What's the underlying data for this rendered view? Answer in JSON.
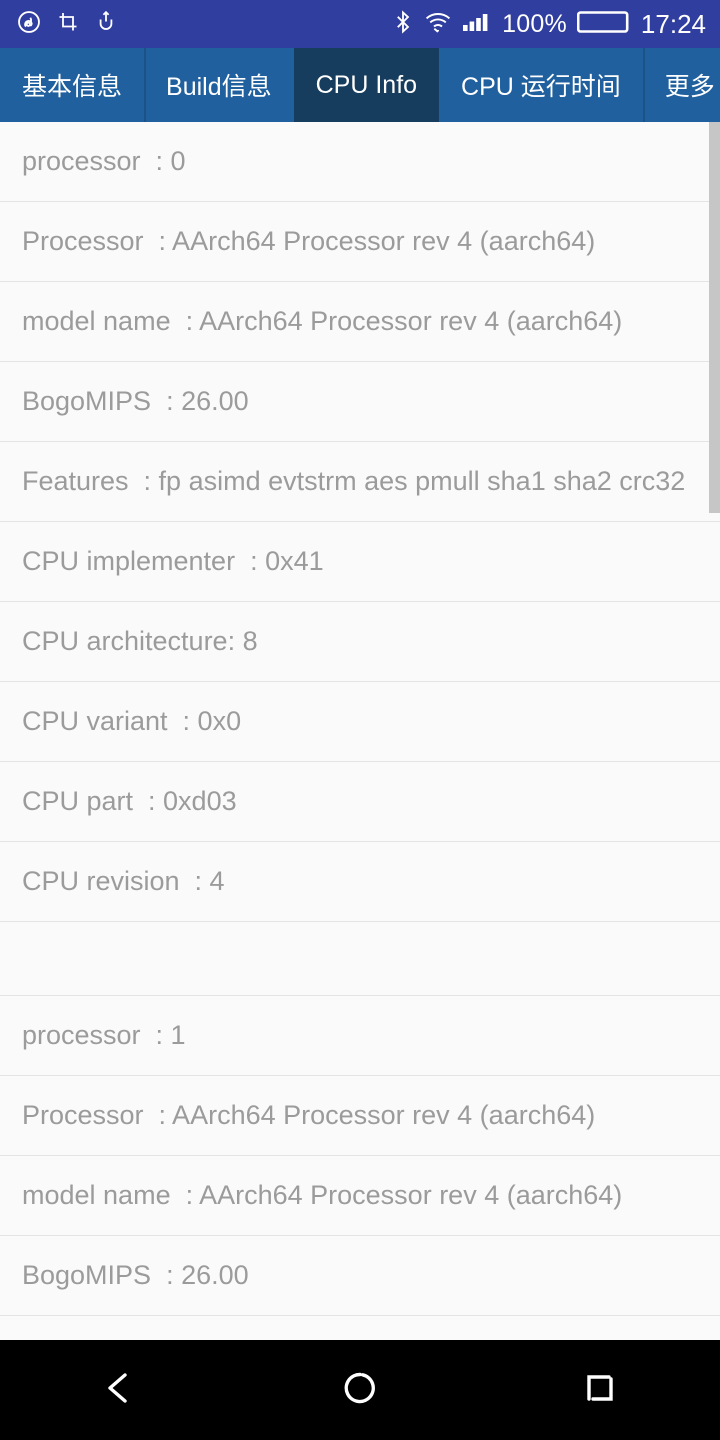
{
  "statusbar": {
    "notification_icons": [
      "music-note-icon",
      "screenshot-crop-icon",
      "usb-debug-icon"
    ],
    "bluetooth_icon": "bluetooth-icon",
    "wifi_icon": "wifi-icon",
    "signal_icon": "cellular-signal-icon",
    "battery_percent": "100%",
    "battery_icon": "battery-full-icon",
    "clock": "17:24"
  },
  "tabs": [
    {
      "label": "基本信息",
      "selected": false
    },
    {
      "label": "Build信息",
      "selected": false
    },
    {
      "label": "CPU Info",
      "selected": true
    },
    {
      "label": "CPU 运行时间",
      "selected": false
    },
    {
      "label": "更多",
      "selected": false
    }
  ],
  "cpu_info_rows": [
    {
      "text": "processor\t: 0"
    },
    {
      "text": "Processor\t: AArch64 Processor rev 4 (aarch64)"
    },
    {
      "text": "model name\t: AArch64 Processor rev 4 (aarch64)"
    },
    {
      "text": "BogoMIPS\t: 26.00"
    },
    {
      "text": "Features\t: fp asimd evtstrm aes pmull sha1 sha2 crc32"
    },
    {
      "text": "CPU implementer\t: 0x41"
    },
    {
      "text": "CPU architecture: 8"
    },
    {
      "text": "CPU variant\t: 0x0"
    },
    {
      "text": "CPU part\t: 0xd03"
    },
    {
      "text": "CPU revision\t: 4"
    },
    {
      "text": ""
    },
    {
      "text": "processor\t: 1"
    },
    {
      "text": "Processor\t: AArch64 Processor rev 4 (aarch64)"
    },
    {
      "text": "model name\t: AArch64 Processor rev 4 (aarch64)"
    },
    {
      "text": "BogoMIPS\t: 26.00"
    }
  ],
  "navbar": {
    "back_label": "back-icon",
    "home_label": "home-icon",
    "recents_label": "recents-icon"
  },
  "colors": {
    "status_bar": "#303f9f",
    "tab_bar": "#21609f",
    "tab_selected": "#173d5e",
    "list_background": "#fafafa",
    "list_text": "#9b9b9b",
    "divider": "#e4e4e4",
    "scrollbar": "#c6c6c6",
    "nav_bar": "#000000"
  }
}
